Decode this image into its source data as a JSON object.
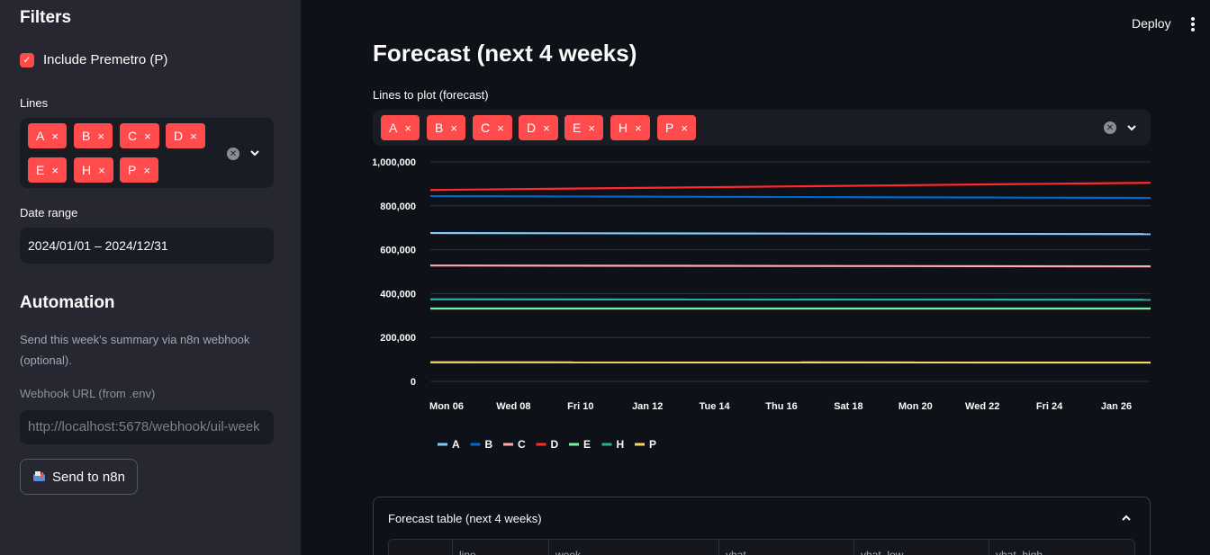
{
  "sidebar": {
    "title": "Filters",
    "include_premetro_label": "Include Premetro (P)",
    "include_premetro_checked": true,
    "lines_label": "Lines",
    "lines_selected": [
      "A",
      "B",
      "C",
      "D",
      "E",
      "H",
      "P"
    ],
    "date_range_label": "Date range",
    "date_range_value": "2024/01/01 – 2024/12/31",
    "automation_title": "Automation",
    "automation_caption": "Send this week's summary via n8n webhook (optional).",
    "webhook_label": "Webhook URL (from .env)",
    "webhook_value": "http://localhost:5678/webhook/uil-week",
    "send_button_label": "Send to n8n",
    "chip_close": "×"
  },
  "header": {
    "deploy_label": "Deploy"
  },
  "main": {
    "title": "Forecast (next 4 weeks)",
    "lines_to_plot_label": "Lines to plot (forecast)",
    "lines_to_plot_selected": [
      "A",
      "B",
      "C",
      "D",
      "E",
      "H",
      "P"
    ],
    "expander_title": "Forecast table (next 4 weeks)",
    "table_columns": [
      "",
      "line",
      "week",
      "yhat",
      "yhat_low",
      "yhat_high"
    ]
  },
  "chart_data": {
    "type": "line",
    "x": [
      "Mon 06",
      "Wed 08",
      "Fri 10",
      "Jan 12",
      "Tue 14",
      "Thu 16",
      "Sat 18",
      "Mon 20",
      "Wed 22",
      "Fri 24",
      "Jan 26"
    ],
    "y_ticks": [
      "0",
      "200,000",
      "400,000",
      "600,000",
      "800,000",
      "1,000,000"
    ],
    "ylim": [
      0,
      1000000
    ],
    "grid": true,
    "legend_position": "bottom-left",
    "series": [
      {
        "name": "A",
        "color": "#83c9ff",
        "start": 676000,
        "end": 671000
      },
      {
        "name": "B",
        "color": "#0068c9",
        "start": 844000,
        "end": 836000
      },
      {
        "name": "C",
        "color": "#ffabab",
        "start": 528000,
        "end": 524000
      },
      {
        "name": "D",
        "color": "#ff2b2b",
        "start": 872000,
        "end": 905000
      },
      {
        "name": "E",
        "color": "#7defa1",
        "start": 332000,
        "end": 332000
      },
      {
        "name": "H",
        "color": "#29b09d",
        "start": 374000,
        "end": 372000
      },
      {
        "name": "P",
        "color": "#ffd16a",
        "start": 87000,
        "end": 86000
      }
    ]
  }
}
